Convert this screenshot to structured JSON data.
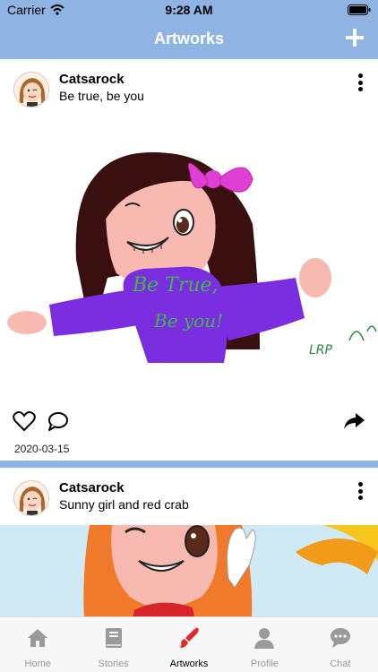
{
  "status_bar": {
    "carrier": "Carrier",
    "time": "9:28 AM"
  },
  "header": {
    "title": "Artworks",
    "add_icon": "plus-icon"
  },
  "posts": [
    {
      "author": "Catsarock",
      "caption": "Be true, be you",
      "date": "2020-03-15",
      "artwork_text": [
        "Be True,",
        "Be you!"
      ],
      "signature": "LRP"
    },
    {
      "author": "Catsarock",
      "caption": "Sunny girl and red crab"
    }
  ],
  "tabs": [
    {
      "label": "Home",
      "icon": "home-icon",
      "active": false
    },
    {
      "label": "Stories",
      "icon": "book-icon",
      "active": false
    },
    {
      "label": "Artworks",
      "icon": "brush-icon",
      "active": true
    },
    {
      "label": "Profile",
      "icon": "person-icon",
      "active": false
    },
    {
      "label": "Chat",
      "icon": "chat-bubble-icon",
      "active": false
    }
  ],
  "colors": {
    "accent": "#8fb4e3",
    "active_tab": "#e0282e",
    "inactive_tab": "#999999"
  }
}
